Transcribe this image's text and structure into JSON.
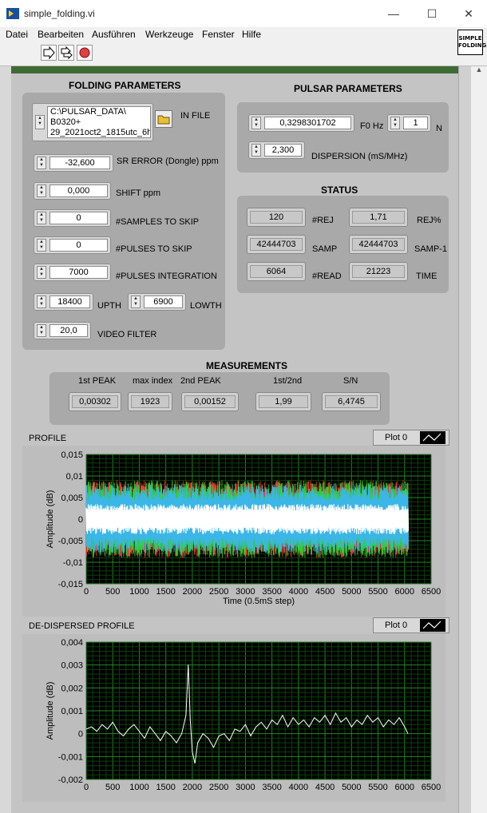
{
  "window": {
    "title": "simple_folding.vi",
    "minimize": "—",
    "maximize": "☐",
    "close": "✕"
  },
  "menu": [
    "Datei",
    "Bearbeiten",
    "Ausführen",
    "Werkzeuge",
    "Fenster",
    "Hilfe"
  ],
  "vi_icon_text": "SIMPLE FOLDING",
  "folding": {
    "title": "FOLDING PARAMETERS",
    "in_file": {
      "label": "IN FILE",
      "lines": [
        "C:\\PULSAR_DATA\\",
        "B0320+",
        "29_2021oct2_1815utc_6h"
      ]
    },
    "sr_error": {
      "label": "SR ERROR (Dongle) ppm",
      "value": "-32,600"
    },
    "shift": {
      "label": "SHIFT ppm",
      "value": "0,000"
    },
    "samples_skip": {
      "label": "#SAMPLES TO SKIP",
      "value": "0"
    },
    "pulses_skip": {
      "label": "#PULSES TO SKIP",
      "value": "0"
    },
    "pulses_integration": {
      "label": "#PULSES INTEGRATION",
      "value": "7000"
    },
    "upth": {
      "label": "UPTH",
      "value": "18400"
    },
    "lowth": {
      "label": "LOWTH",
      "value": "6900"
    },
    "video_filter": {
      "label": "VIDEO FILTER",
      "value": "20,0"
    }
  },
  "pulsar": {
    "title": "PULSAR PARAMETERS",
    "f0": {
      "label": "F0 Hz",
      "value": "0,3298301702"
    },
    "n": {
      "label": "N",
      "value": "1"
    },
    "dispersion": {
      "label": "DISPERSION (mS/MHz)",
      "value": "2,300"
    }
  },
  "status": {
    "title": "STATUS",
    "rej": {
      "label": "#REJ",
      "value": "120"
    },
    "rej_pct": {
      "label": "REJ%",
      "value": "1,71"
    },
    "samp": {
      "label": "SAMP",
      "value": "42444703"
    },
    "samp1": {
      "label": "SAMP-1",
      "value": "42444703"
    },
    "read": {
      "label": "#READ",
      "value": "6064"
    },
    "time": {
      "label": "TIME",
      "value": "21223"
    }
  },
  "measurements": {
    "title": "MEASUREMENTS",
    "first_peak": {
      "label": "1st PEAK",
      "value": "0,00302"
    },
    "max_index": {
      "label": "max index",
      "value": "1923"
    },
    "second_peak": {
      "label": "2nd PEAK",
      "value": "0,00152"
    },
    "ratio": {
      "label": "1st/2nd",
      "value": "1,99"
    },
    "sn": {
      "label": "S/N",
      "value": "6,4745"
    }
  },
  "chart_data": [
    {
      "type": "line",
      "title": "PROFILE",
      "legend": "Plot 0",
      "xlabel": "Time (0.5mS step)",
      "ylabel": "Amplitude (dB)",
      "xlim": [
        0,
        6500
      ],
      "ylim": [
        -0.015,
        0.015
      ],
      "x_ticks": [
        "0",
        "500",
        "1000",
        "1500",
        "2000",
        "2500",
        "3000",
        "3500",
        "4000",
        "4500",
        "5000",
        "5500",
        "6000",
        "6500"
      ],
      "y_ticks": [
        "0,015",
        "0,01",
        "0,005",
        "0",
        "-0,005",
        "-0,01",
        "-0,015"
      ],
      "grid": true,
      "series": [
        {
          "color": "#ffffff",
          "band": [
            -0.0035,
            0.0035
          ]
        },
        {
          "color": "#ff3030",
          "band": [
            -0.009,
            0.009
          ]
        },
        {
          "color": "#30d030",
          "band": [
            -0.009,
            0.009
          ]
        },
        {
          "color": "#3cb6e6",
          "band": [
            -0.008,
            0.008
          ]
        }
      ],
      "x_extent": [
        0,
        6064
      ]
    },
    {
      "type": "line",
      "title": "DE-DISPERSED PROFILE",
      "legend": "Plot 0",
      "xlabel": "",
      "ylabel": "Amplitude (dB)",
      "xlim": [
        0,
        6500
      ],
      "ylim": [
        -0.002,
        0.004
      ],
      "x_ticks": [
        "0",
        "500",
        "1000",
        "1500",
        "2000",
        "2500",
        "3000",
        "3500",
        "4000",
        "4500",
        "5000",
        "5500",
        "6000",
        "6500"
      ],
      "y_ticks": [
        "0,004",
        "0,003",
        "0,002",
        "0,001",
        "0",
        "-0,001",
        "-0,002"
      ],
      "grid": true,
      "series": [
        {
          "color": "#ffffff",
          "points": [
            [
              0,
              0.0002
            ],
            [
              100,
              0.0003
            ],
            [
              200,
              0.0001
            ],
            [
              300,
              0.0004
            ],
            [
              400,
              0.0002
            ],
            [
              500,
              0.0005
            ],
            [
              600,
              0.0001
            ],
            [
              700,
              -0.0001
            ],
            [
              800,
              0.0002
            ],
            [
              900,
              0.0004
            ],
            [
              1000,
              0.0001
            ],
            [
              1100,
              -0.0002
            ],
            [
              1200,
              0.0003
            ],
            [
              1300,
              0.0
            ],
            [
              1400,
              -0.0003
            ],
            [
              1500,
              0.0001
            ],
            [
              1600,
              -0.0001
            ],
            [
              1700,
              -0.0004
            ],
            [
              1800,
              0.0
            ],
            [
              1880,
              0.0008
            ],
            [
              1923,
              0.00302
            ],
            [
              1960,
              0.0006
            ],
            [
              2000,
              -0.0008
            ],
            [
              2050,
              -0.0013
            ],
            [
              2100,
              -0.0004
            ],
            [
              2200,
              0.0
            ],
            [
              2300,
              -0.0002
            ],
            [
              2400,
              -0.0006
            ],
            [
              2500,
              -0.0001
            ],
            [
              2600,
              0.0
            ],
            [
              2700,
              -0.0003
            ],
            [
              2800,
              0.0002
            ],
            [
              2900,
              0.0001
            ],
            [
              3000,
              0.0004
            ],
            [
              3100,
              -0.0001
            ],
            [
              3200,
              0.0003
            ],
            [
              3300,
              0.0005
            ],
            [
              3400,
              0.0002
            ],
            [
              3500,
              0.0006
            ],
            [
              3600,
              0.0004
            ],
            [
              3700,
              0.0008
            ],
            [
              3800,
              0.0003
            ],
            [
              3900,
              0.0007
            ],
            [
              4000,
              0.0004
            ],
            [
              4100,
              0.0006
            ],
            [
              4200,
              0.0003
            ],
            [
              4300,
              0.0007
            ],
            [
              4400,
              0.0005
            ],
            [
              4500,
              0.0008
            ],
            [
              4600,
              0.0004
            ],
            [
              4700,
              0.0009
            ],
            [
              4800,
              0.0005
            ],
            [
              4900,
              0.0007
            ],
            [
              5000,
              0.0003
            ],
            [
              5100,
              0.0006
            ],
            [
              5200,
              0.0004
            ],
            [
              5300,
              0.0008
            ],
            [
              5400,
              0.0005
            ],
            [
              5500,
              0.0007
            ],
            [
              5600,
              0.0003
            ],
            [
              5700,
              0.0006
            ],
            [
              5800,
              0.0004
            ],
            [
              5900,
              0.0007
            ],
            [
              6000,
              0.0003
            ],
            [
              6064,
              0.0
            ]
          ]
        }
      ]
    }
  ]
}
